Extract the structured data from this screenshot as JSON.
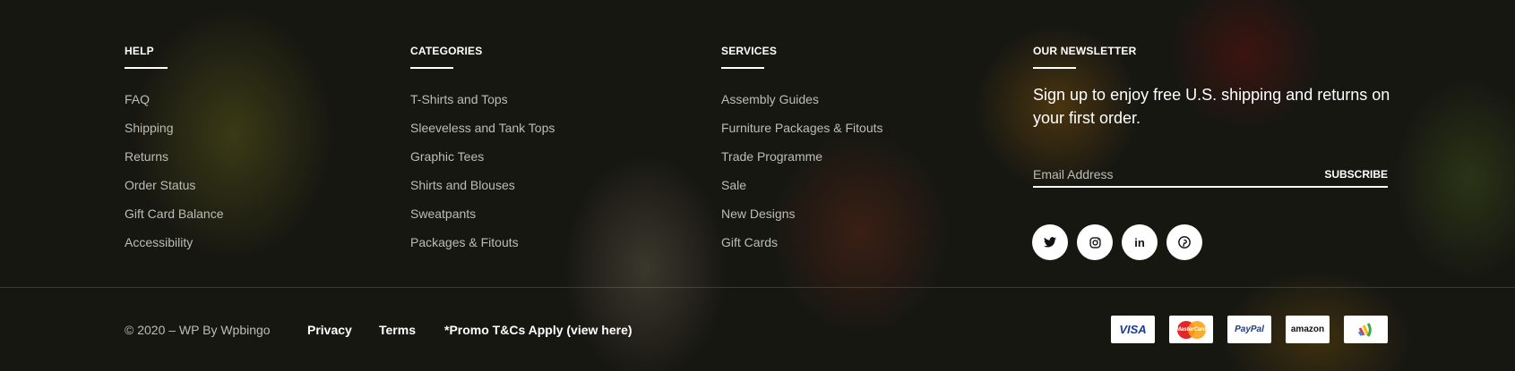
{
  "help": {
    "title": "HELP",
    "items": [
      "FAQ",
      "Shipping",
      "Returns",
      "Order Status",
      "Gift Card Balance",
      "Accessibility"
    ]
  },
  "categories": {
    "title": "CATEGORIES",
    "items": [
      "T-Shirts and Tops",
      "Sleeveless and Tank Tops",
      "Graphic Tees",
      "Shirts and Blouses",
      "Sweatpants",
      "Packages & Fitouts"
    ]
  },
  "services": {
    "title": "SERVICES",
    "items": [
      "Assembly Guides",
      "Furniture Packages & Fitouts",
      "Trade Programme",
      "Sale",
      "New Designs",
      "Gift Cards"
    ]
  },
  "newsletter": {
    "title": "OUR NEWSLETTER",
    "text": "Sign up to enjoy free U.S. shipping and returns on your first order.",
    "placeholder": "Email Address",
    "button": "SUBSCRIBE"
  },
  "social": [
    {
      "icon": "twitter-icon",
      "glyph": "🐦"
    },
    {
      "icon": "instagram-icon",
      "glyph": "◎"
    },
    {
      "icon": "linkedin-icon",
      "glyph": "in"
    },
    {
      "icon": "pinterest-icon",
      "glyph": "℗"
    }
  ],
  "bottom": {
    "copyright": "© 2020 – WP By Wpbingo",
    "links": [
      "Privacy",
      "Terms",
      "*Promo T&Cs Apply (view here)"
    ]
  },
  "payments": {
    "visa": "VISA",
    "mastercard": "MasterCard",
    "paypal": "PayPal",
    "amazon": "amazon",
    "wallet": "Google Wallet"
  }
}
